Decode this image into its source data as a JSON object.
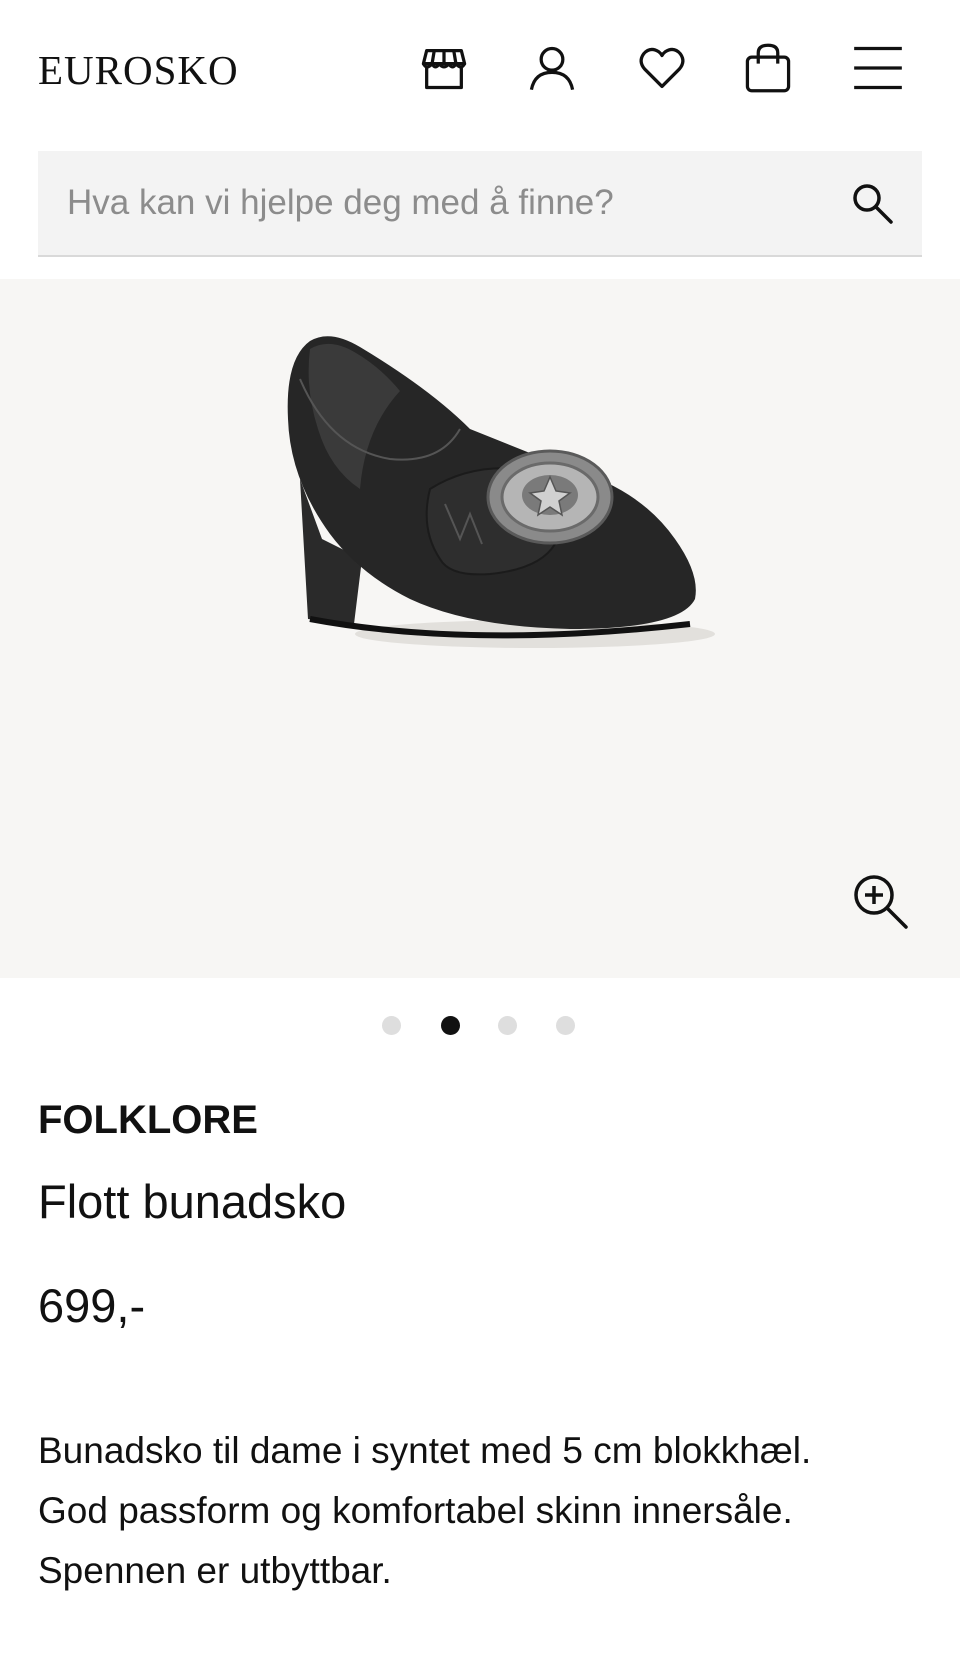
{
  "header": {
    "logo": "EUROSKO",
    "icons": [
      "store-icon",
      "user-icon",
      "heart-icon",
      "bag-icon",
      "menu-icon"
    ]
  },
  "search": {
    "placeholder": "Hva kan vi hjelpe deg med å finne?",
    "value": ""
  },
  "gallery": {
    "image": "shoe-image",
    "dots_total": 4,
    "active_dot": 2
  },
  "product": {
    "brand": "FOLKLORE",
    "name": "Flott bunadsko",
    "price": "699,-",
    "description": [
      "Bunadsko til dame i syntet med 5 cm blokkhæl.",
      "God passform og komfortabel skinn innersåle.",
      "Spennen er utbyttbar."
    ]
  }
}
